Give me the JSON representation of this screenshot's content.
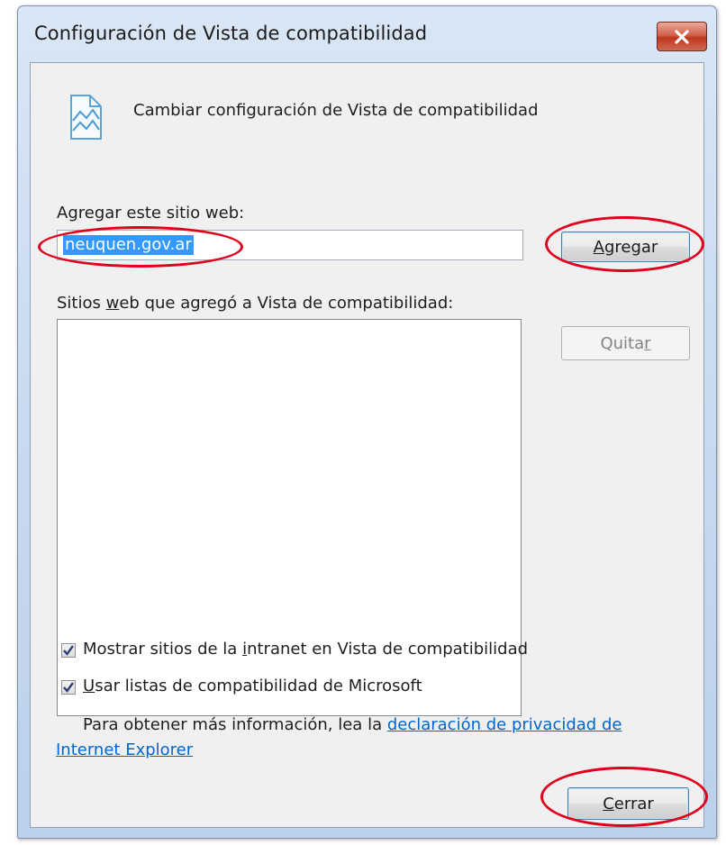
{
  "window": {
    "title": "Configuración de Vista de compatibilidad"
  },
  "header": {
    "icon": "compat-view-icon",
    "text": "Cambiar configuración de Vista de compatibilidad"
  },
  "add_section": {
    "label_pre": "A",
    "label_u": "g",
    "label_post": "regar este sitio web:",
    "input_value": "neuquen.gov.ar",
    "add_button_u": "A",
    "add_button_rest": "gregar"
  },
  "list_section": {
    "label_pre": "Sitios ",
    "label_u": "w",
    "label_post": "eb que agregó a Vista de compatibilidad:",
    "remove_button_pre": "Quita",
    "remove_button_u": "r"
  },
  "options": {
    "intranet_pre": "Mostrar sitios de la ",
    "intranet_u": "i",
    "intranet_post": "ntranet en Vista de compatibilidad",
    "intranet_checked": true,
    "microsoft_u": "U",
    "microsoft_post": "sar listas de compatibilidad de Microsoft",
    "microsoft_checked": true
  },
  "info": {
    "text": "Para obtener más información, lea la ",
    "link_line1": "declaración de privacidad de",
    "link_line2": "Internet Explorer"
  },
  "footer": {
    "close_u": "C",
    "close_rest": "errar"
  },
  "annotation_color": "#e0001b"
}
